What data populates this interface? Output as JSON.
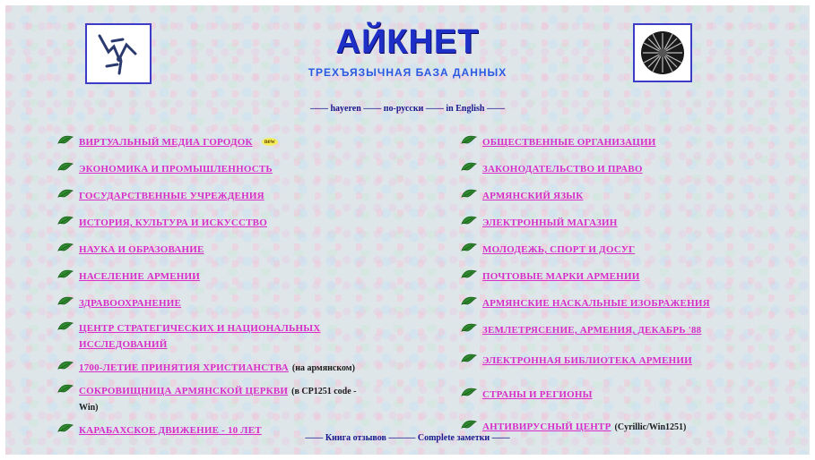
{
  "header": {
    "title": "АЙКНЕТ",
    "subtitle": "ТРЕХЪЯЗЫЧНАЯ БАЗА ДАННЫХ"
  },
  "languages": {
    "armenian_label": "hayeren",
    "russian_label": "по-русски",
    "english_label": "in English"
  },
  "left_items": [
    {
      "label": "ВИРТУАЛЬНЫЙ МЕДИА ГОРОДОК",
      "badge": "new"
    },
    {
      "label": "ЭКОНОМИКА И ПРОМЫШЛЕННОСТЬ"
    },
    {
      "label": "ГОСУДАРСТВЕННЫЕ УЧРЕЖДЕНИЯ"
    },
    {
      "label": "ИСТОРИЯ, КУЛЬТУРА И ИСКУССТВО"
    },
    {
      "label": "НАУКА И ОБРАЗОВАНИЕ"
    },
    {
      "label": "НАСЕЛЕНИЕ АРМЕНИИ"
    },
    {
      "label": "ЗДРАВООХРАНЕНИЕ"
    },
    {
      "label": "ЦЕНТР СТРАТЕГИЧЕСКИХ И НАЦИОНАЛЬНЫХ ИССЛЕДОВАНИЙ"
    },
    {
      "label": "1700-ЛЕТИЕ ПРИНЯТИЯ ХРИСТИАНСТВА",
      "note": "(на армянском)"
    },
    {
      "label": "СОКРОВИЩНИЦА АРМЯНСКОЙ ЦЕРКВИ",
      "note": "(в CP1251 code - Win)"
    },
    {
      "label": "КАРАБАХСКОЕ ДВИЖЕНИЕ - 10 ЛЕТ"
    }
  ],
  "right_items": [
    {
      "label": "ОБЩЕСТВЕННЫЕ ОРГАНИЗАЦИИ"
    },
    {
      "label": "ЗАКОНОДАТЕЛЬСТВО И ПРАВО"
    },
    {
      "label": "АРМЯНСКИЙ ЯЗЫК"
    },
    {
      "label": "ЭЛЕКТРОННЫЙ МАГАЗИН"
    },
    {
      "label": "МОЛОДЕЖЬ, СПОРТ И ДОСУГ"
    },
    {
      "label": "ПОЧТОВЫЕ МАРКИ АРМЕНИИ"
    },
    {
      "label": "АРМЯНСКИЕ НАСКАЛЬНЫЕ ИЗОБРАЖЕНИЯ"
    },
    {
      "label": "ЗЕМЛЕТРЯСЕНИЕ, АРМЕНИЯ, ДЕКАБРЬ '88"
    },
    {
      "label": "ЭЛЕКТРОННАЯ БИБЛИОТЕКА АРМЕНИИ"
    },
    {
      "label": "СТРАНЫ И РЕГИОНЫ"
    },
    {
      "label": "АНТИВИРУСНЫЙ ЦЕНТР",
      "note": "(Cyrillic/Win1251)"
    }
  ],
  "footer": {
    "guestbook_label": "Книга отзывов",
    "complaint_label": "Complete заметки"
  },
  "colors": {
    "title": "#1e2fc8",
    "link": "#d62fc8",
    "leaf": "#2f8a2f"
  },
  "icons": {
    "left_logo": "icknet-logo-icon",
    "right_logo": "round-emblem-icon",
    "bullet": "leaf-bullet-icon"
  }
}
